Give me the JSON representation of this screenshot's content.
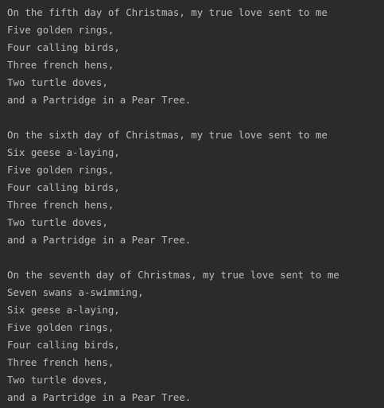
{
  "console": {
    "stanzas": [
      {
        "lines": [
          "On the fifth day of Christmas, my true love sent to me",
          "Five golden rings,",
          "Four calling birds,",
          "Three french hens,",
          "Two turtle doves,",
          "and a Partridge in a Pear Tree."
        ]
      },
      {
        "lines": [
          "On the sixth day of Christmas, my true love sent to me",
          "Six geese a-laying,",
          "Five golden rings,",
          "Four calling birds,",
          "Three french hens,",
          "Two turtle doves,",
          "and a Partridge in a Pear Tree."
        ]
      },
      {
        "lines": [
          "On the seventh day of Christmas, my true love sent to me",
          "Seven swans a-swimming,",
          "Six geese a-laying,",
          "Five golden rings,",
          "Four calling birds,",
          "Three french hens,",
          "Two turtle doves,",
          "and a Partridge in a Pear Tree."
        ]
      }
    ]
  },
  "colors": {
    "background": "#2b2b2b",
    "text": "#b9bcbf"
  }
}
